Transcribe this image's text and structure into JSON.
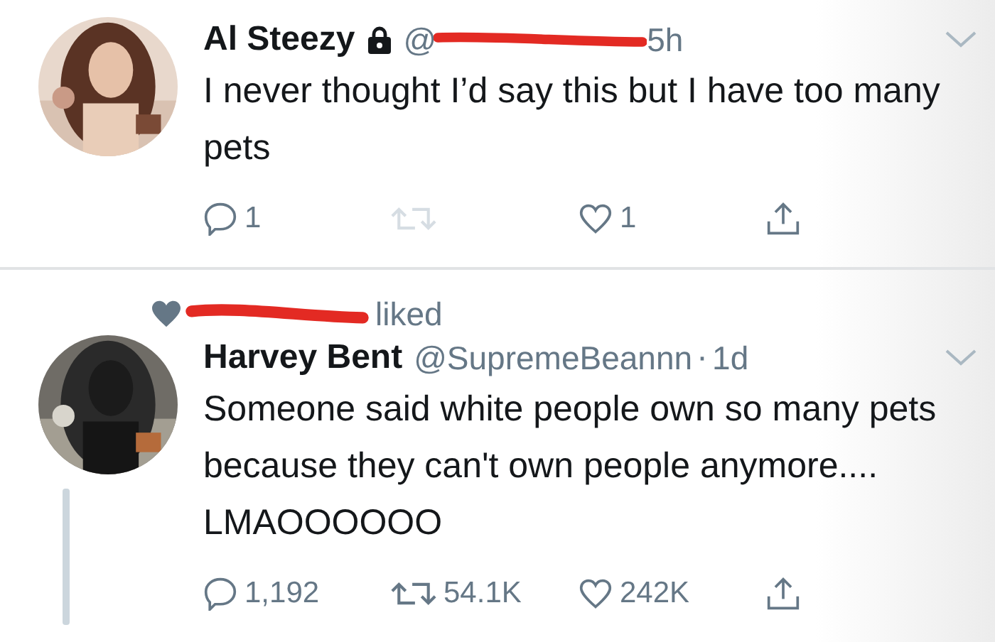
{
  "tweets": [
    {
      "name": "Al Steezy",
      "protected": true,
      "handle": "@",
      "handle_redacted": true,
      "time": "5h",
      "text": "I never thought I’d say this but I have too many pets",
      "thread_line": false,
      "actions": [
        {
          "kind": "reply",
          "count": "1",
          "disabled": false
        },
        {
          "kind": "retweet",
          "disabled": true
        },
        {
          "kind": "like",
          "count": "1",
          "disabled": false
        },
        {
          "kind": "share",
          "disabled": false
        }
      ]
    },
    {
      "social_context": {
        "text": "liked",
        "redacted": true
      },
      "name": "Harvey Bent",
      "protected": false,
      "handle": "@SupremeBeannn",
      "handle_redacted": false,
      "separator": "·",
      "time": "1d",
      "text": "Someone said white people own so many pets because they can't own people anymore.... LMAOOOOOO",
      "thread_line": true,
      "actions": [
        {
          "kind": "reply",
          "count": "1,192",
          "disabled": false
        },
        {
          "kind": "retweet",
          "count": "54.1K",
          "disabled": false
        },
        {
          "kind": "like",
          "count": "242K",
          "disabled": false
        },
        {
          "kind": "share",
          "disabled": false
        }
      ]
    }
  ]
}
